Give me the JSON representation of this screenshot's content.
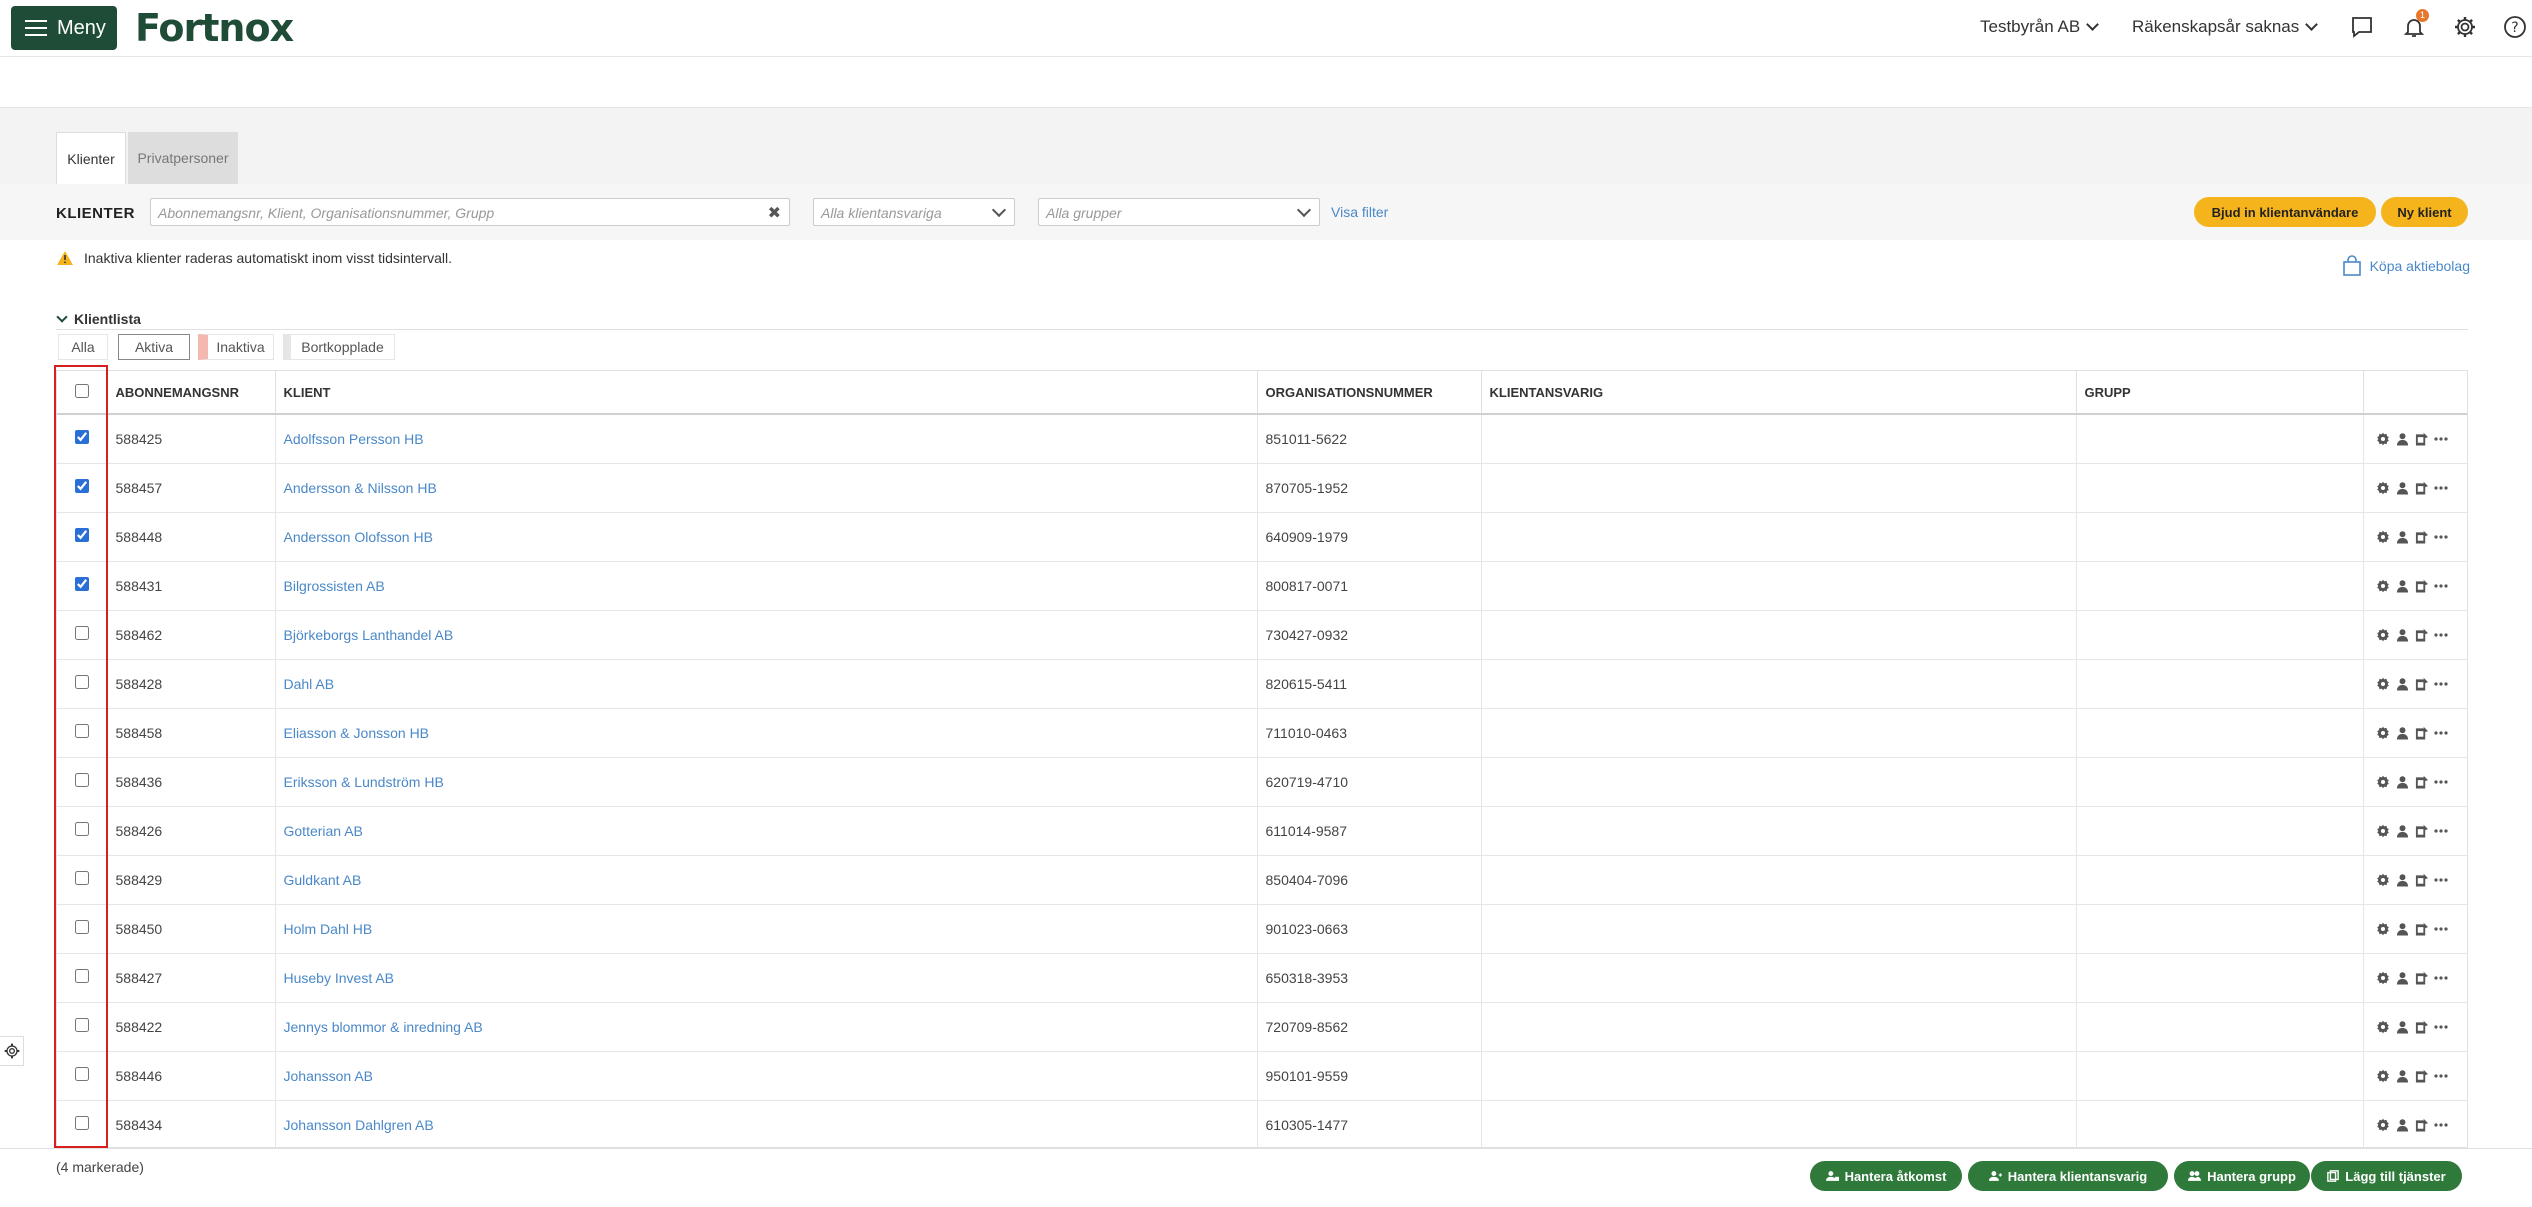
{
  "header": {
    "menu_label": "Meny",
    "logo_text": "Fortnox",
    "company": "Testbyrån AB",
    "fiscal_year": "Räkenskapsår saknas",
    "notification_count": "1"
  },
  "tabs": [
    {
      "label": "Klienter",
      "active": true
    },
    {
      "label": "Privatpersoner",
      "active": false
    }
  ],
  "filters": {
    "title": "KLIENTER",
    "search_placeholder": "Abonnemangsnr, Klient, Organisationsnummer, Grupp",
    "responsible_placeholder": "Alla klientansvariga",
    "group_placeholder": "Alla grupper",
    "show_filter": "Visa filter",
    "invite_button": "Bjud in klientanvändare",
    "new_client_button": "Ny klient"
  },
  "notice": {
    "warning_text": "Inaktiva klienter raderas automatiskt inom visst tidsintervall.",
    "buy_link": "Köpa aktiebolag"
  },
  "client_list": {
    "title": "Klientlista",
    "status_filters": [
      "Alla",
      "Aktiva",
      "Inaktiva",
      "Bortkopplade"
    ]
  },
  "table": {
    "columns": [
      "ABONNEMANGSNR",
      "KLIENT",
      "ORGANISATIONSNUMMER",
      "KLIENTANSVARIG",
      "GRUPP"
    ],
    "rows": [
      {
        "checked": true,
        "sub": "588425",
        "client": "Adolfsson Persson HB",
        "org": "851011-5622"
      },
      {
        "checked": true,
        "sub": "588457",
        "client": "Andersson & Nilsson HB",
        "org": "870705-1952"
      },
      {
        "checked": true,
        "sub": "588448",
        "client": "Andersson Olofsson HB",
        "org": "640909-1979"
      },
      {
        "checked": true,
        "sub": "588431",
        "client": "Bilgrossisten AB",
        "org": "800817-0071"
      },
      {
        "checked": false,
        "sub": "588462",
        "client": "Björkeborgs Lanthandel AB",
        "org": "730427-0932"
      },
      {
        "checked": false,
        "sub": "588428",
        "client": "Dahl AB",
        "org": "820615-5411"
      },
      {
        "checked": false,
        "sub": "588458",
        "client": "Eliasson & Jonsson HB",
        "org": "711010-0463"
      },
      {
        "checked": false,
        "sub": "588436",
        "client": "Eriksson & Lundström HB",
        "org": "620719-4710"
      },
      {
        "checked": false,
        "sub": "588426",
        "client": "Gotterian AB",
        "org": "611014-9587"
      },
      {
        "checked": false,
        "sub": "588429",
        "client": "Guldkant AB",
        "org": "850404-7096"
      },
      {
        "checked": false,
        "sub": "588450",
        "client": "Holm Dahl HB",
        "org": "901023-0663"
      },
      {
        "checked": false,
        "sub": "588427",
        "client": "Huseby Invest AB",
        "org": "650318-3953"
      },
      {
        "checked": false,
        "sub": "588422",
        "client": "Jennys blommor & inredning AB",
        "org": "720709-8562"
      },
      {
        "checked": false,
        "sub": "588446",
        "client": "Johansson AB",
        "org": "950101-9559"
      },
      {
        "checked": false,
        "sub": "588434",
        "client": "Johansson Dahlgren AB",
        "org": "610305-1477"
      }
    ]
  },
  "footer": {
    "selected_count": "(4 markerade)",
    "buttons": [
      "Hantera åtkomst",
      "Hantera klientansvarig",
      "Hantera grupp",
      "Lägg till tjänster"
    ]
  },
  "colors": {
    "brand_green": "#1f4c36",
    "action_green": "#2f7a3b",
    "accent_yellow": "#f5b41c",
    "link_blue": "#4a88c8",
    "highlight_red": "#d62020"
  }
}
